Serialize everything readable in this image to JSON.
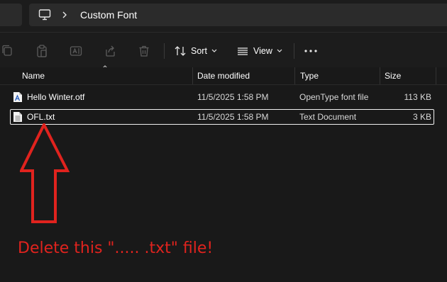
{
  "address_bar": {
    "crumb": "Custom Font",
    "icons": [
      "computer-icon",
      "chevron-right-icon"
    ]
  },
  "toolbar": {
    "icons": [
      "copy-icon",
      "paste-icon",
      "rename-icon",
      "share-icon",
      "delete-icon"
    ],
    "sort_label": "Sort",
    "view_label": "View",
    "more_icon": "more-icon"
  },
  "columns": {
    "name": "Name",
    "date": "Date modified",
    "type": "Type",
    "size": "Size"
  },
  "files": [
    {
      "name": "Hello Winter.otf",
      "date": "11/5/2025 1:58 PM",
      "type": "OpenType font file",
      "size": "113 KB",
      "icon": "font-file-icon",
      "selected": false
    },
    {
      "name": "OFL.txt",
      "date": "11/5/2025 1:58 PM",
      "type": "Text Document",
      "size": "3 KB",
      "icon": "text-file-icon",
      "selected": true
    }
  ],
  "annotation": {
    "text": "Delete this \"..... .txt\" file!",
    "color": "#e0231e"
  }
}
